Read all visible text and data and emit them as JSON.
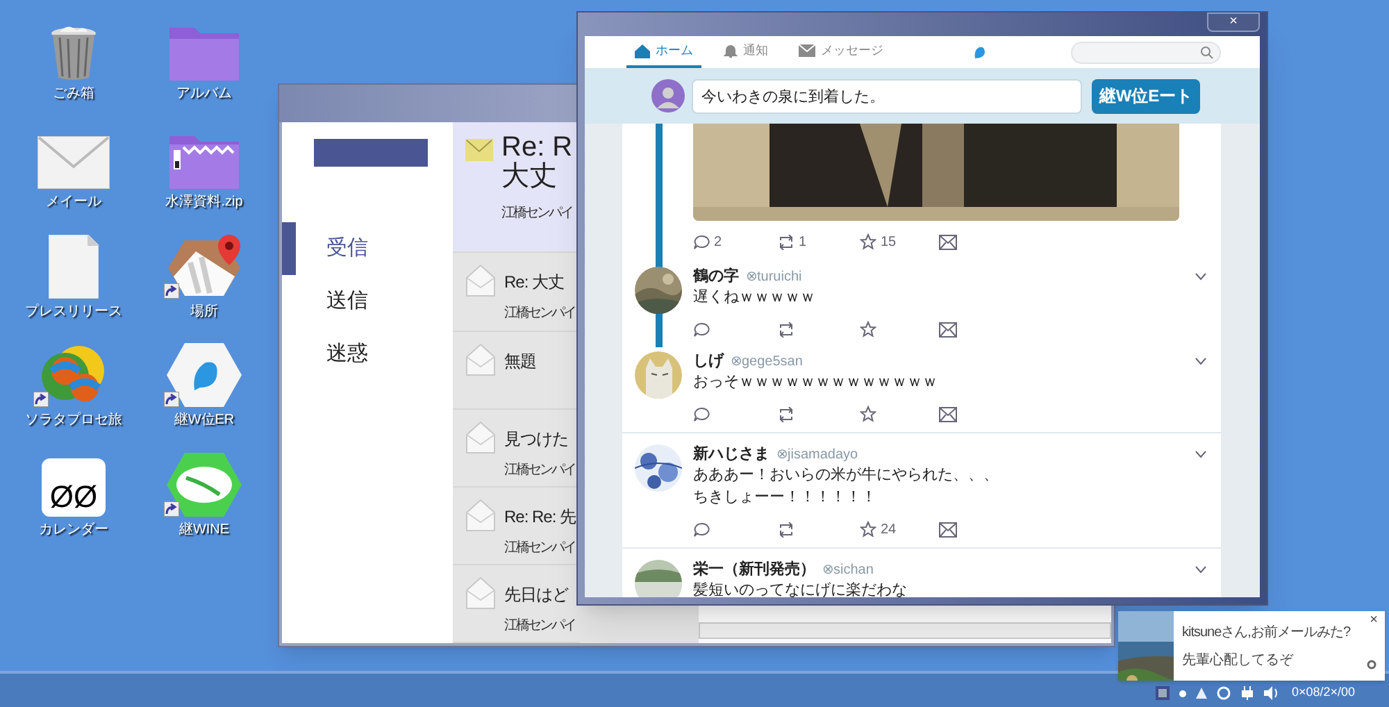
{
  "desktop_icons": [
    {
      "label": "ごみ箱",
      "kind": "trash",
      "shortcut": false
    },
    {
      "label": "アルバム",
      "kind": "folder",
      "shortcut": false
    },
    {
      "label": "メイール",
      "kind": "mail",
      "shortcut": false
    },
    {
      "label": "水澤資料.zip",
      "kind": "zip",
      "shortcut": false
    },
    {
      "label": "プレスリリース",
      "kind": "doc",
      "shortcut": false
    },
    {
      "label": "場所",
      "kind": "map",
      "shortcut": true
    },
    {
      "label": "ソラタプロセ旅",
      "kind": "swirl",
      "shortcut": true
    },
    {
      "label": "継W位ER",
      "kind": "bird",
      "shortcut": true
    },
    {
      "label": "カレンダー",
      "kind": "calendar",
      "glyph": "ØØ",
      "shortcut": false
    },
    {
      "label": "継WINE",
      "kind": "chat",
      "shortcut": true
    }
  ],
  "mail_window": {
    "folders": [
      {
        "label": "受信",
        "selected": true
      },
      {
        "label": "送信",
        "selected": false
      },
      {
        "label": "迷惑",
        "selected": false
      }
    ],
    "messages": [
      {
        "subject": "Re: R",
        "subject_line2": "大丈",
        "sender": "江橋センパイ",
        "selected": true
      },
      {
        "subject": "Re: 大丈",
        "sender": "江橋センパイ",
        "selected": false
      },
      {
        "subject": "無題",
        "selected": false
      },
      {
        "subject": "見つけた",
        "sender": "江橋センパイ",
        "selected": false
      },
      {
        "subject": "Re: Re: 先",
        "sender": "江橋センパイ",
        "selected": false
      },
      {
        "subject": "先日はど",
        "sender": "江橋センパイ",
        "selected": false
      }
    ]
  },
  "social_window": {
    "close": "×",
    "tabs": [
      {
        "label": "ホーム",
        "kind": "home",
        "selected": true
      },
      {
        "label": "通知",
        "kind": "bell",
        "selected": false
      },
      {
        "label": "メッセージ",
        "kind": "mail",
        "selected": false
      }
    ],
    "compose": {
      "value": "今いわきの泉に到着した。",
      "button": "継W位Eート"
    },
    "tweets": [
      {
        "thread": true,
        "replies": "2",
        "retweets": "1",
        "likes": "15"
      },
      {
        "kind": "text",
        "thread": true,
        "name": "鶴の字",
        "handle": "⊗turuichi",
        "lines": [
          "遅くねｗｗｗｗｗ"
        ]
      },
      {
        "kind": "text",
        "thread": false,
        "name": "しげ",
        "handle": "⊗gege5san",
        "lines": [
          "おっそｗｗｗｗｗｗｗｗｗｗｗｗｗ"
        ]
      },
      {
        "kind": "text",
        "thread": false,
        "name": "新ハじさま",
        "handle": "⊗jisamadayo",
        "lines": [
          "あああー！おいらの米が牛にやられた、、、",
          "ちきしょーー！！！！！！"
        ],
        "likes": "24"
      },
      {
        "kind": "text",
        "thread": false,
        "name": "栄一（新刊発売）",
        "handle": "⊗sichan",
        "lines": [
          "髪短いのってなにげに楽だわな"
        ],
        "cut": true
      }
    ]
  },
  "notification": {
    "close": "×",
    "lines": [
      "kitsuneさん,お前メールみた?",
      "先輩心配してるぞ"
    ]
  },
  "taskbar": {
    "clock": "0×08/2×/00"
  }
}
